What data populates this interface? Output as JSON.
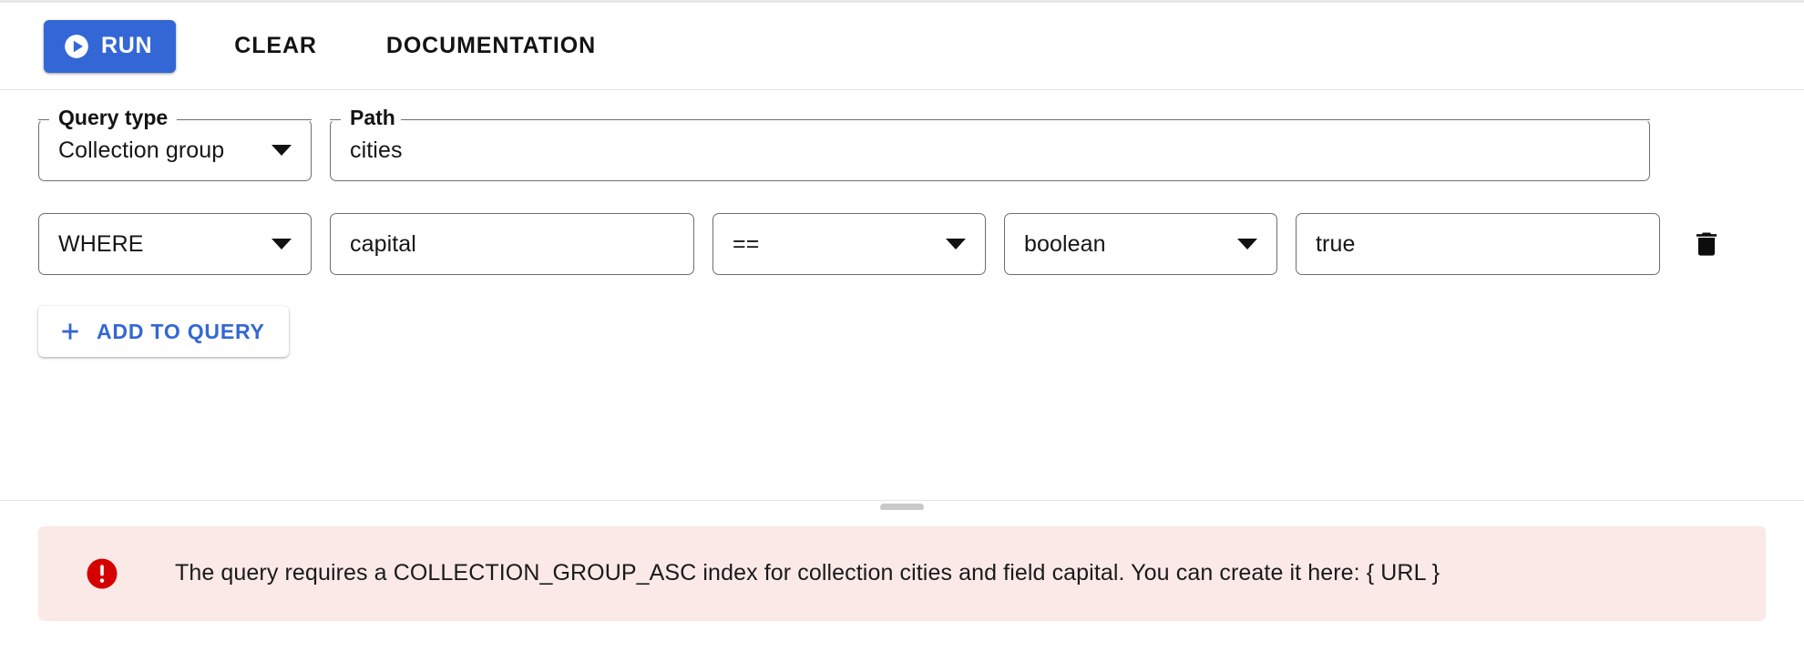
{
  "toolbar": {
    "run_label": "RUN",
    "run_icon": "play-circle-icon",
    "run_color": "#3367d6",
    "clear_label": "CLEAR",
    "documentation_label": "DOCUMENTATION"
  },
  "query_builder": {
    "query_type": {
      "label": "Query type",
      "value": "Collection group",
      "arrow_icon": "chevron-down-icon"
    },
    "path": {
      "label": "Path",
      "value": "cities",
      "placeholder": ""
    },
    "clauses": [
      {
        "operation": {
          "label": "",
          "value": "WHERE",
          "arrow_icon": "chevron-down-icon"
        },
        "field": {
          "label": "",
          "value": "capital",
          "placeholder": ""
        },
        "operator": {
          "label": "",
          "value": "==",
          "arrow_icon": "chevron-down-icon"
        },
        "type": {
          "label": "",
          "value": "boolean",
          "arrow_icon": "chevron-down-icon"
        },
        "value_field": {
          "label": "",
          "value": "true",
          "placeholder": ""
        },
        "delete_icon": "trash-icon"
      }
    ],
    "add_to_query": {
      "label": "ADD TO QUERY",
      "icon": "plus-icon",
      "color": "#3367d6"
    }
  },
  "divider": {
    "handle_icon": "drag-handle-icon"
  },
  "results": {
    "error": {
      "icon": "error-circle-icon",
      "icon_color": "#d50000",
      "background": "#fbe9e7",
      "message": "The query requires a COLLECTION_GROUP_ASC index for collection cities and field capital. You can create it here: { URL }"
    }
  }
}
